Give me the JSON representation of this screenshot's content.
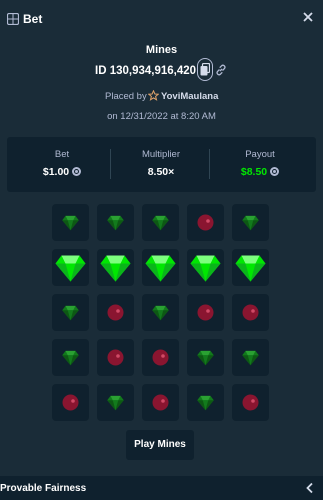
{
  "header": {
    "title": "Bet",
    "icon": "bet-slip-icon",
    "close_icon": "close-icon"
  },
  "game": {
    "name": "Mines",
    "bet_id": "ID 130,934,916,420"
  },
  "placed": {
    "prefix": "Placed by",
    "username": "YoviMaulana",
    "date": "on 12/31/2022 at 8:20 AM"
  },
  "stats": [
    {
      "label": "Bet",
      "value": "$1.00"
    },
    {
      "label": "Multiplier",
      "value": "8.50×"
    },
    {
      "label": "Payout",
      "value": "$8.50"
    }
  ],
  "board": [
    [
      "gem",
      "gem",
      "gem",
      "mine",
      "gem"
    ],
    [
      "gem-revealed",
      "gem-revealed",
      "gem-revealed",
      "gem-revealed",
      "gem-revealed"
    ],
    [
      "gem",
      "mine",
      "gem",
      "mine",
      "mine"
    ],
    [
      "gem",
      "mine",
      "mine",
      "gem",
      "gem"
    ],
    [
      "mine",
      "gem",
      "mine",
      "gem",
      "mine"
    ]
  ],
  "actions": {
    "play_label": "Play Mines"
  },
  "footer": {
    "label": "Provable Fairness"
  },
  "colors": {
    "background": "#1a2c38",
    "panel": "#0f212e",
    "payout": "#00e701",
    "gem": "#00e701",
    "mine": "#8a1530"
  }
}
